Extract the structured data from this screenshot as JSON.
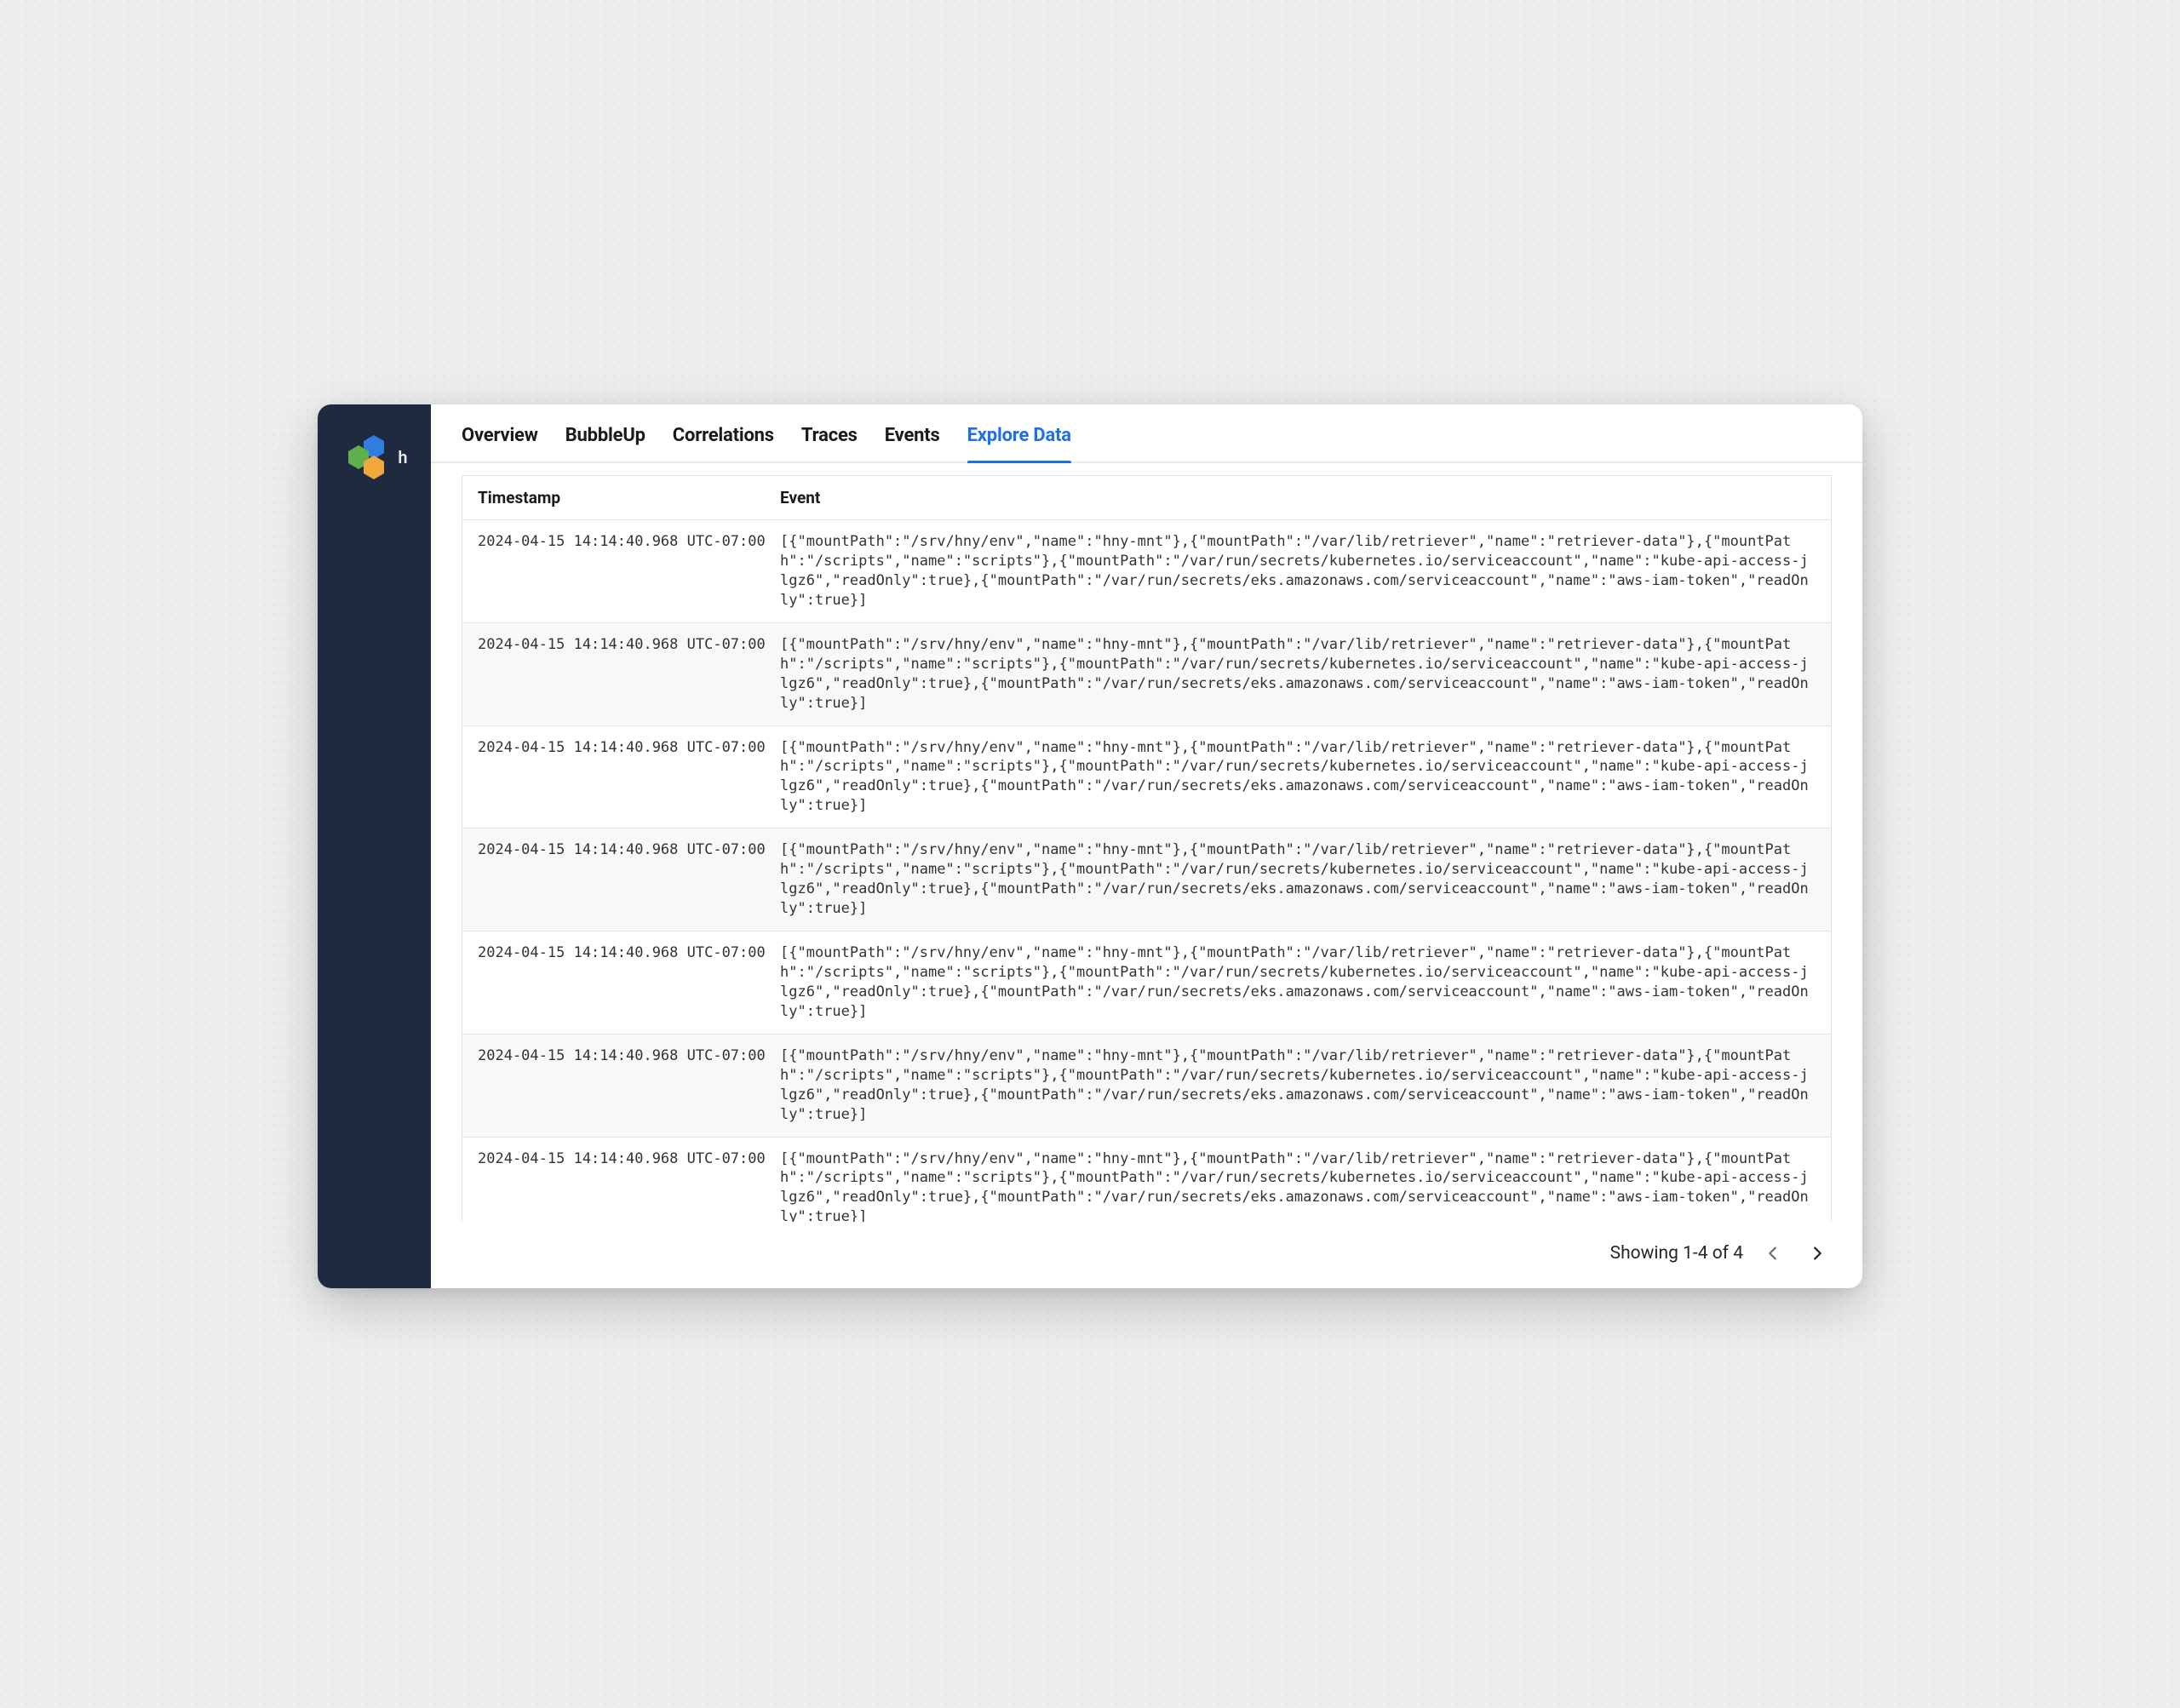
{
  "sidebar": {
    "logo_letter": "h"
  },
  "tabs": [
    {
      "label": "Overview",
      "active": false
    },
    {
      "label": "BubbleUp",
      "active": false
    },
    {
      "label": "Correlations",
      "active": false
    },
    {
      "label": "Traces",
      "active": false
    },
    {
      "label": "Events",
      "active": false
    },
    {
      "label": "Explore Data",
      "active": true
    }
  ],
  "table": {
    "headers": {
      "timestamp": "Timestamp",
      "event": "Event"
    },
    "rows": [
      {
        "timestamp": "2024-04-15 14:14:40.968 UTC-07:00",
        "event": "[{\"mountPath\":\"/srv/hny/env\",\"name\":\"hny-mnt\"},{\"mountPath\":\"/var/lib/retriever\",\"name\":\"retriever-data\"},{\"mountPath\":\"/scripts\",\"name\":\"scripts\"},{\"mountPath\":\"/var/run/secrets/kubernetes.io/serviceaccount\",\"name\":\"kube-api-access-jlgz6\",\"readOnly\":true},{\"mountPath\":\"/var/run/secrets/eks.amazonaws.com/serviceaccount\",\"name\":\"aws-iam-token\",\"readOnly\":true}]"
      },
      {
        "timestamp": "2024-04-15 14:14:40.968 UTC-07:00",
        "event": "[{\"mountPath\":\"/srv/hny/env\",\"name\":\"hny-mnt\"},{\"mountPath\":\"/var/lib/retriever\",\"name\":\"retriever-data\"},{\"mountPath\":\"/scripts\",\"name\":\"scripts\"},{\"mountPath\":\"/var/run/secrets/kubernetes.io/serviceaccount\",\"name\":\"kube-api-access-jlgz6\",\"readOnly\":true},{\"mountPath\":\"/var/run/secrets/eks.amazonaws.com/serviceaccount\",\"name\":\"aws-iam-token\",\"readOnly\":true}]"
      },
      {
        "timestamp": "2024-04-15 14:14:40.968 UTC-07:00",
        "event": "[{\"mountPath\":\"/srv/hny/env\",\"name\":\"hny-mnt\"},{\"mountPath\":\"/var/lib/retriever\",\"name\":\"retriever-data\"},{\"mountPath\":\"/scripts\",\"name\":\"scripts\"},{\"mountPath\":\"/var/run/secrets/kubernetes.io/serviceaccount\",\"name\":\"kube-api-access-jlgz6\",\"readOnly\":true},{\"mountPath\":\"/var/run/secrets/eks.amazonaws.com/serviceaccount\",\"name\":\"aws-iam-token\",\"readOnly\":true}]"
      },
      {
        "timestamp": "2024-04-15 14:14:40.968 UTC-07:00",
        "event": "[{\"mountPath\":\"/srv/hny/env\",\"name\":\"hny-mnt\"},{\"mountPath\":\"/var/lib/retriever\",\"name\":\"retriever-data\"},{\"mountPath\":\"/scripts\",\"name\":\"scripts\"},{\"mountPath\":\"/var/run/secrets/kubernetes.io/serviceaccount\",\"name\":\"kube-api-access-jlgz6\",\"readOnly\":true},{\"mountPath\":\"/var/run/secrets/eks.amazonaws.com/serviceaccount\",\"name\":\"aws-iam-token\",\"readOnly\":true}]"
      },
      {
        "timestamp": "2024-04-15 14:14:40.968 UTC-07:00",
        "event": "[{\"mountPath\":\"/srv/hny/env\",\"name\":\"hny-mnt\"},{\"mountPath\":\"/var/lib/retriever\",\"name\":\"retriever-data\"},{\"mountPath\":\"/scripts\",\"name\":\"scripts\"},{\"mountPath\":\"/var/run/secrets/kubernetes.io/serviceaccount\",\"name\":\"kube-api-access-jlgz6\",\"readOnly\":true},{\"mountPath\":\"/var/run/secrets/eks.amazonaws.com/serviceaccount\",\"name\":\"aws-iam-token\",\"readOnly\":true}]"
      },
      {
        "timestamp": "2024-04-15 14:14:40.968 UTC-07:00",
        "event": "[{\"mountPath\":\"/srv/hny/env\",\"name\":\"hny-mnt\"},{\"mountPath\":\"/var/lib/retriever\",\"name\":\"retriever-data\"},{\"mountPath\":\"/scripts\",\"name\":\"scripts\"},{\"mountPath\":\"/var/run/secrets/kubernetes.io/serviceaccount\",\"name\":\"kube-api-access-jlgz6\",\"readOnly\":true},{\"mountPath\":\"/var/run/secrets/eks.amazonaws.com/serviceaccount\",\"name\":\"aws-iam-token\",\"readOnly\":true}]"
      },
      {
        "timestamp": "2024-04-15 14:14:40.968 UTC-07:00",
        "event": "[{\"mountPath\":\"/srv/hny/env\",\"name\":\"hny-mnt\"},{\"mountPath\":\"/var/lib/retriever\",\"name\":\"retriever-data\"},{\"mountPath\":\"/scripts\",\"name\":\"scripts\"},{\"mountPath\":\"/var/run/secrets/kubernetes.io/serviceaccount\",\"name\":\"kube-api-access-jlgz6\",\"readOnly\":true},{\"mountPath\":\"/var/run/secrets/eks.amazonaws.com/serviceaccount\",\"name\":\"aws-iam-token\",\"readOnly\":true}]"
      }
    ]
  },
  "pager": {
    "status": "Showing 1-4 of 4"
  },
  "colors": {
    "accent": "#1f6feb",
    "sidebar_bg": "#1f2940"
  }
}
